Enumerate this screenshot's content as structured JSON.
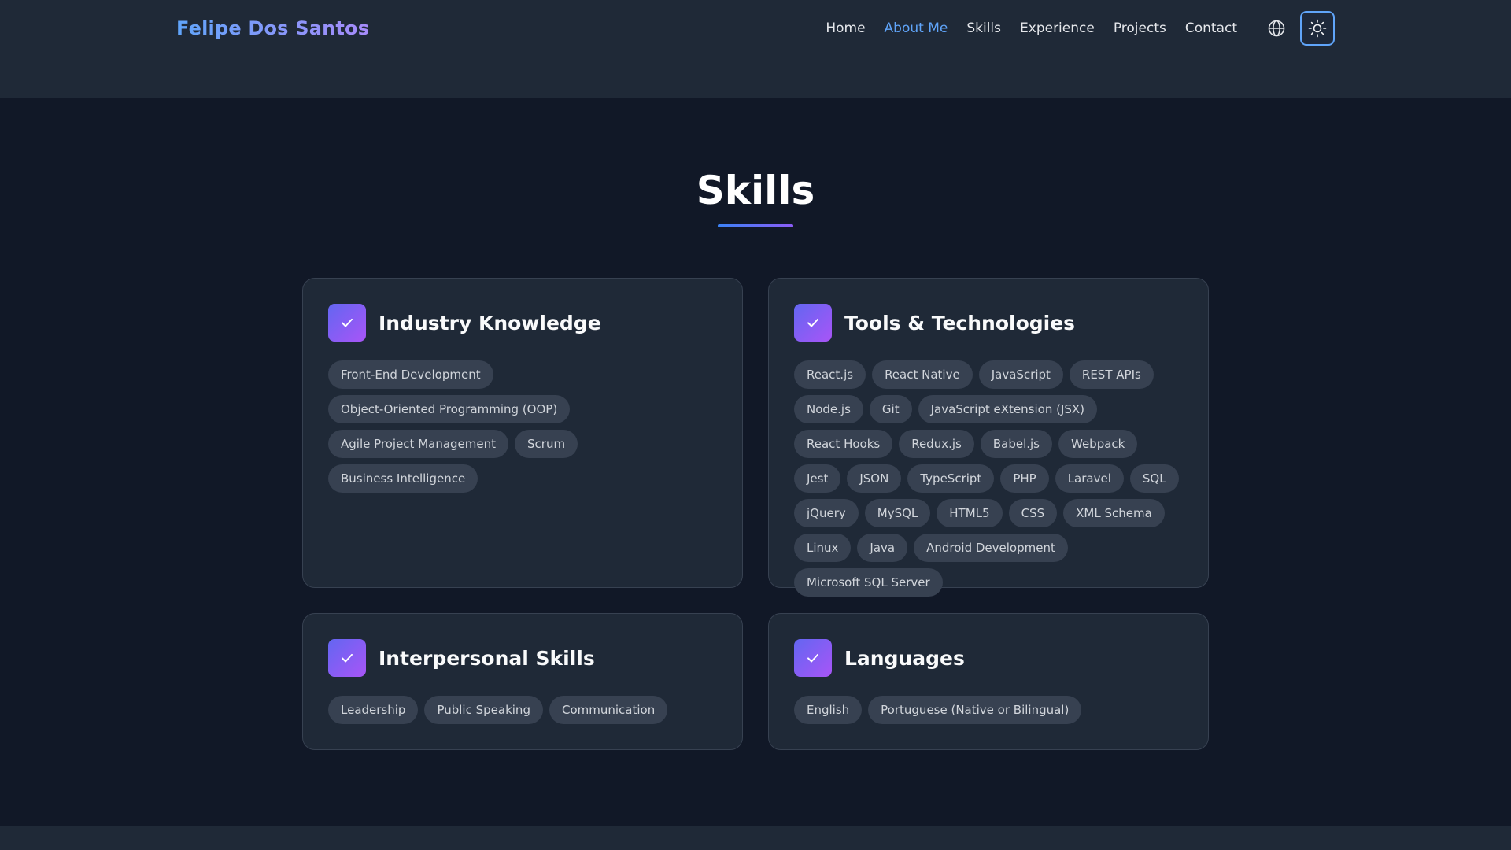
{
  "nav": {
    "brand": "Felipe Dos Santos",
    "links": [
      "Home",
      "About Me",
      "Skills",
      "Experience",
      "Projects",
      "Contact"
    ],
    "active": "About Me"
  },
  "section": {
    "title": "Skills"
  },
  "cards": [
    {
      "title": "Industry Knowledge",
      "tags": [
        "Front-End Development",
        "Object-Oriented Programming (OOP)",
        "Agile Project Management",
        "Scrum",
        "Business Intelligence"
      ]
    },
    {
      "title": "Tools & Technologies",
      "tags": [
        "React.js",
        "React Native",
        "JavaScript",
        "REST APIs",
        "Node.js",
        "Git",
        "JavaScript eXtension (JSX)",
        "React Hooks",
        "Redux.js",
        "Babel.js",
        "Webpack",
        "Jest",
        "JSON",
        "TypeScript",
        "PHP",
        "Laravel",
        "SQL",
        "jQuery",
        "MySQL",
        "HTML5",
        "CSS",
        "XML Schema",
        "Linux",
        "Java",
        "Android Development",
        "Microsoft SQL Server"
      ]
    },
    {
      "title": "Interpersonal Skills",
      "tags": [
        "Leadership",
        "Public Speaking",
        "Communication"
      ]
    },
    {
      "title": "Languages",
      "tags": [
        "English",
        "Portuguese (Native or Bilingual)"
      ]
    }
  ],
  "icons": {
    "language": "globe-icon",
    "theme": "sun-icon",
    "card": "check-icon"
  },
  "colors": {
    "background": "#111827",
    "surface": "#1f2937",
    "accent": "#60a5fa",
    "accent_purple": "#a855f7",
    "tag": "#374151"
  }
}
